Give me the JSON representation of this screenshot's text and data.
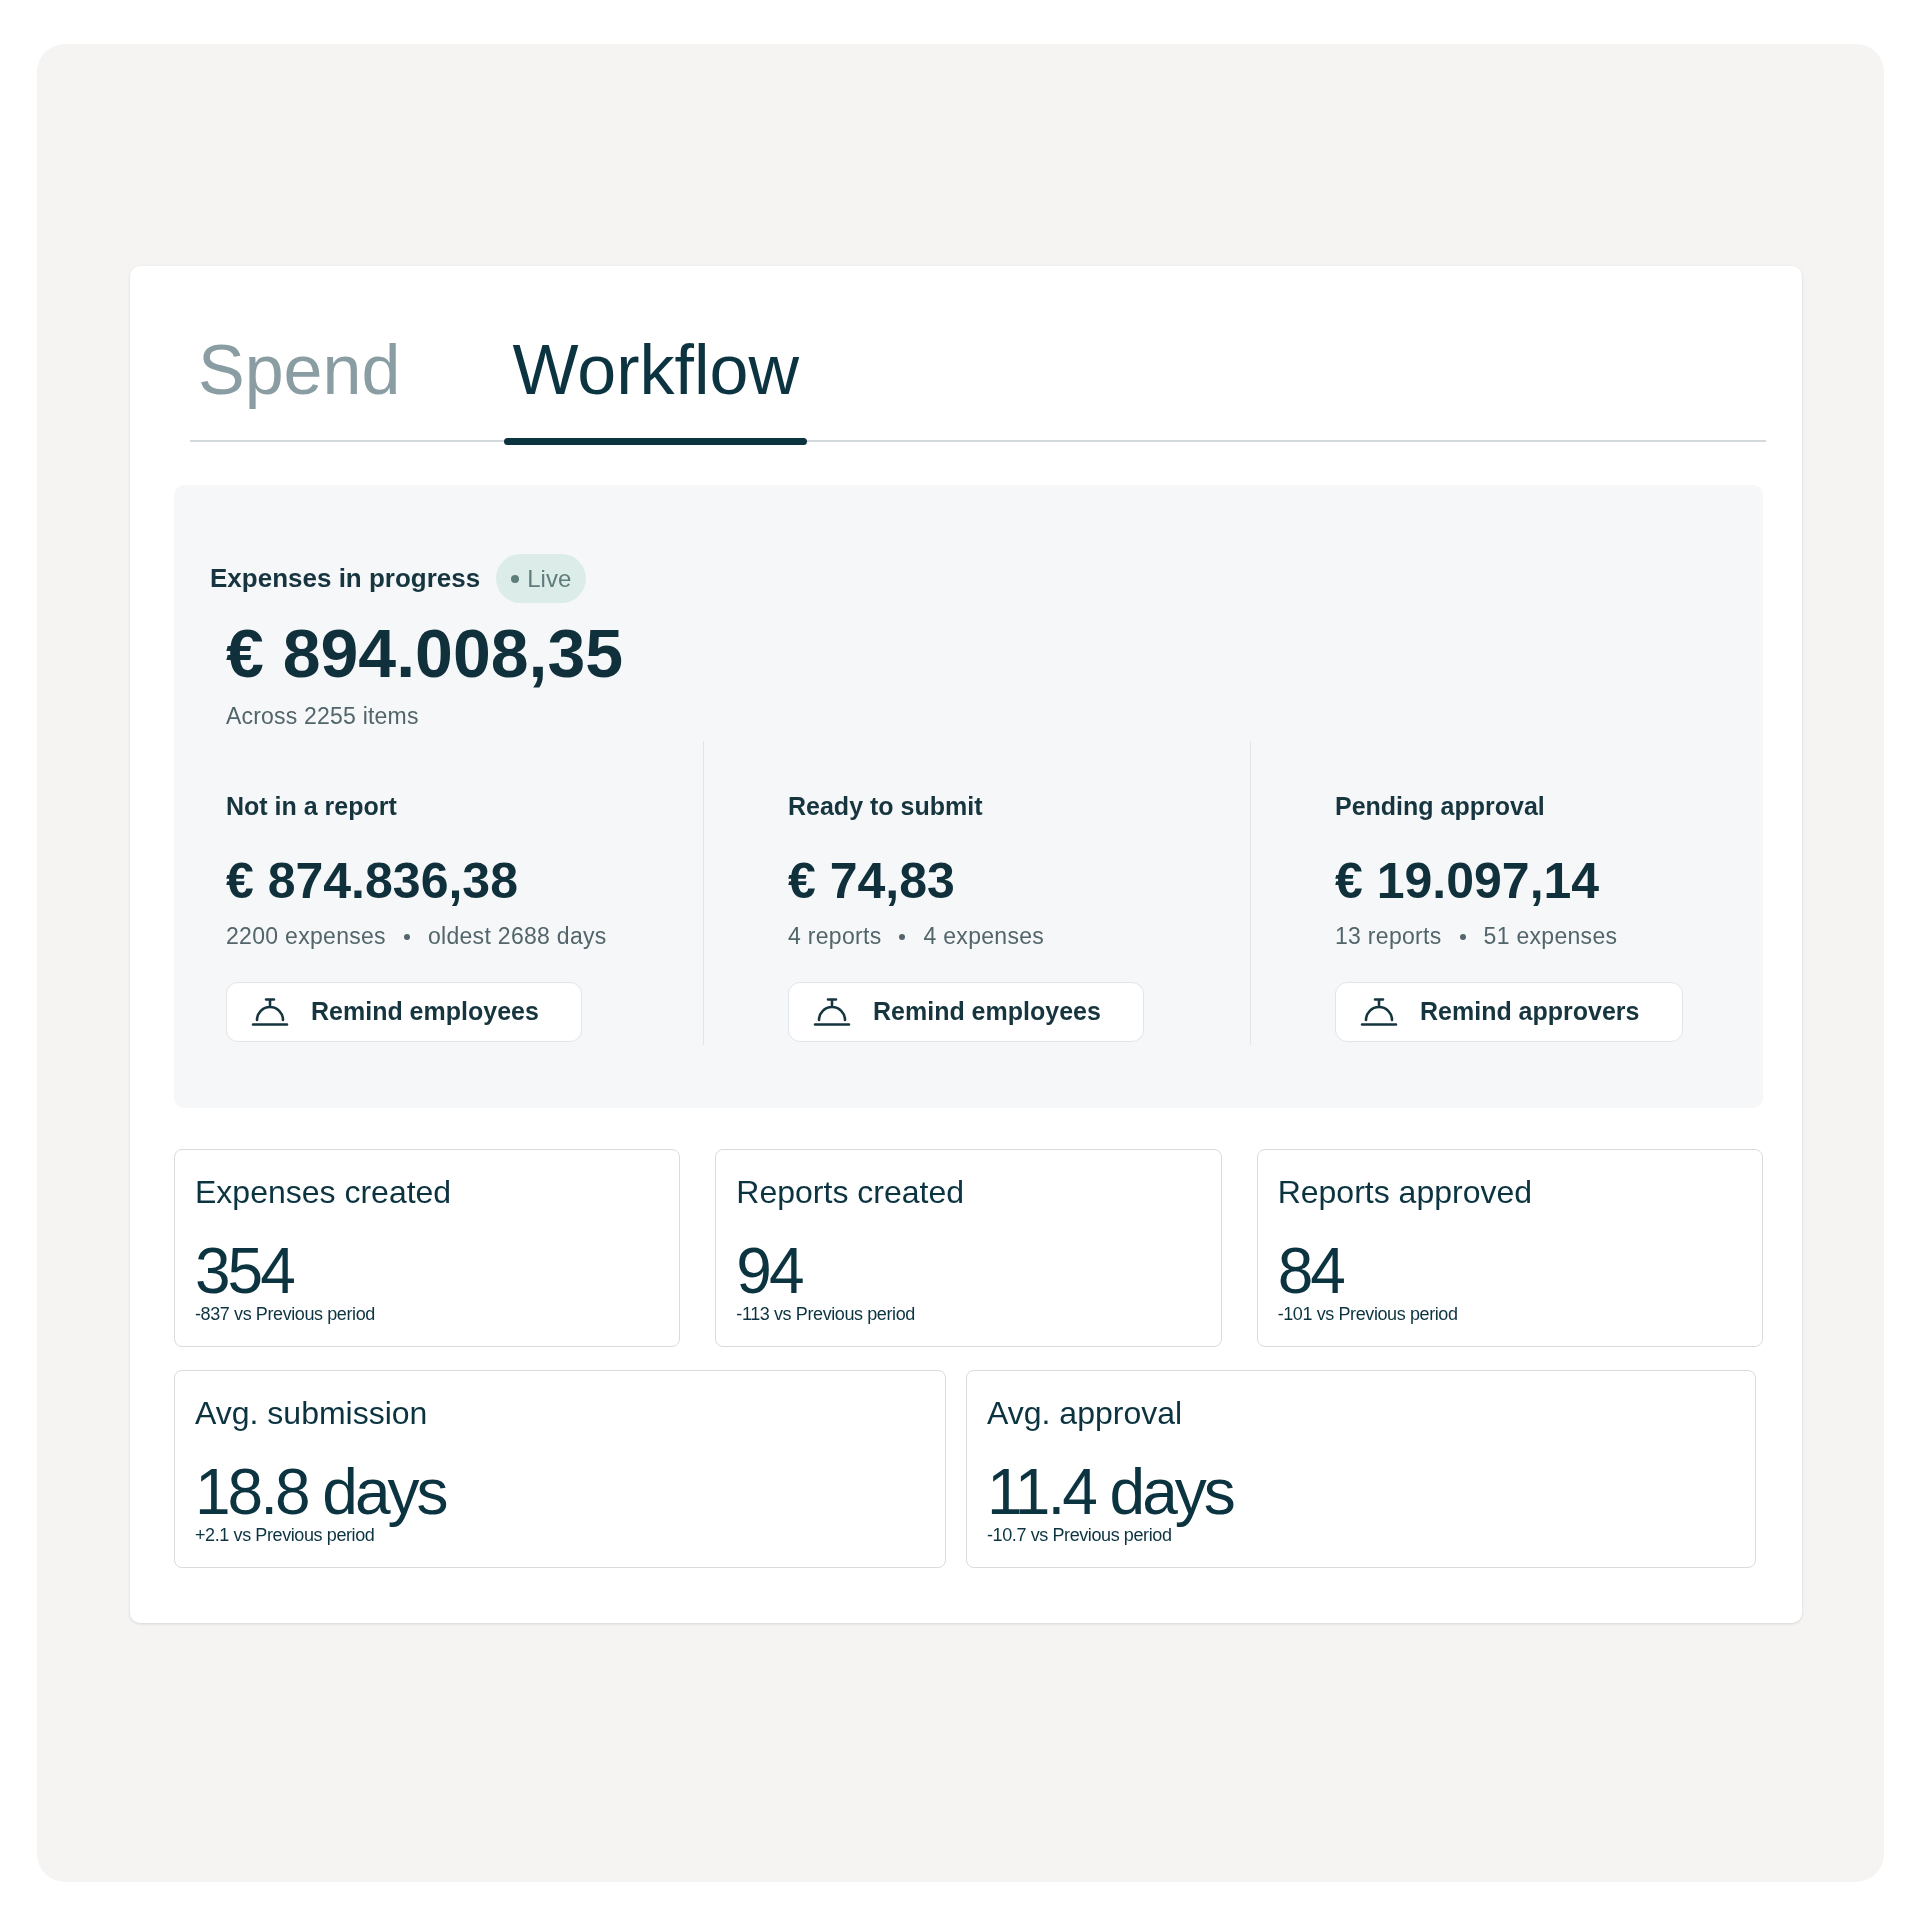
{
  "tabs": [
    {
      "label": "Spend",
      "selected": false
    },
    {
      "label": "Workflow",
      "selected": true
    }
  ],
  "in_progress": {
    "title": "Expenses in progress",
    "badge": "Live",
    "amount": "€ 894.008,35",
    "caption": "Across 2255 items",
    "columns": [
      {
        "title": "Not in a report",
        "amount": "€ 874.836,38",
        "details": [
          "2200 expenses",
          "oldest 2688 days"
        ],
        "button": "Remind employees"
      },
      {
        "title": "Ready to submit",
        "amount": "€ 74,83",
        "details": [
          "4 reports",
          "4 expenses"
        ],
        "button": "Remind employees"
      },
      {
        "title": "Pending approval",
        "amount": "€ 19.097,14",
        "details": [
          "13 reports",
          "51 expenses"
        ],
        "button": "Remind approvers"
      }
    ]
  },
  "stat_rows": [
    {
      "cards": [
        {
          "title": "Expenses created",
          "value": "354",
          "change": "-837 vs Previous period"
        },
        {
          "title": "Reports created",
          "value": "94",
          "change": "-113 vs Previous period"
        },
        {
          "title": "Reports approved",
          "value": "84",
          "change": "-101 vs Previous period"
        }
      ]
    },
    {
      "cards": [
        {
          "title": "Avg. submission",
          "value": "18.8 days",
          "change": "+2.1 vs Previous period"
        },
        {
          "title": "Avg. approval",
          "value": "11.4 days",
          "change": "-10.7 vs Previous period"
        }
      ]
    }
  ]
}
